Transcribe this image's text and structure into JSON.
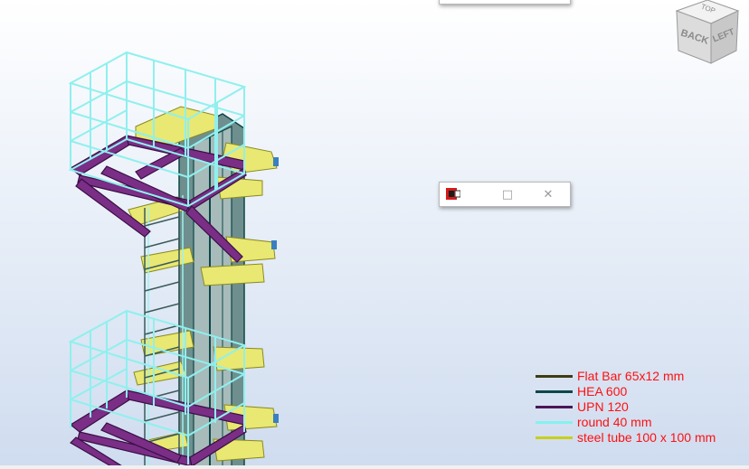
{
  "viewcube": {
    "face_back": "BACK",
    "face_left": "LEFT",
    "face_top": "TOP"
  },
  "mini_window": {
    "app_icon": "robot-app-icon",
    "restore_icon": "restore-icon",
    "maximize_icon": "maximize-icon",
    "close_icon": "close-icon"
  },
  "legend": {
    "items": [
      {
        "label": "Flat Bar 65x12 mm",
        "color": "#3f3c12"
      },
      {
        "label": "HEA 600",
        "color": "#0f4747"
      },
      {
        "label": "UPN 120",
        "color": "#4a1757"
      },
      {
        "label": "round 40 mm",
        "color": "#84f2ee"
      },
      {
        "label": "steel tube 100 x 100 mm",
        "color": "#c8cf1a"
      }
    ]
  },
  "colors": {
    "flat_bar": "#3f3c12",
    "hea": "#0f4747",
    "upn": "#7a2e86",
    "round": "#9ff1ef",
    "tube": "#e8e872",
    "label_text": "#ff1010"
  }
}
